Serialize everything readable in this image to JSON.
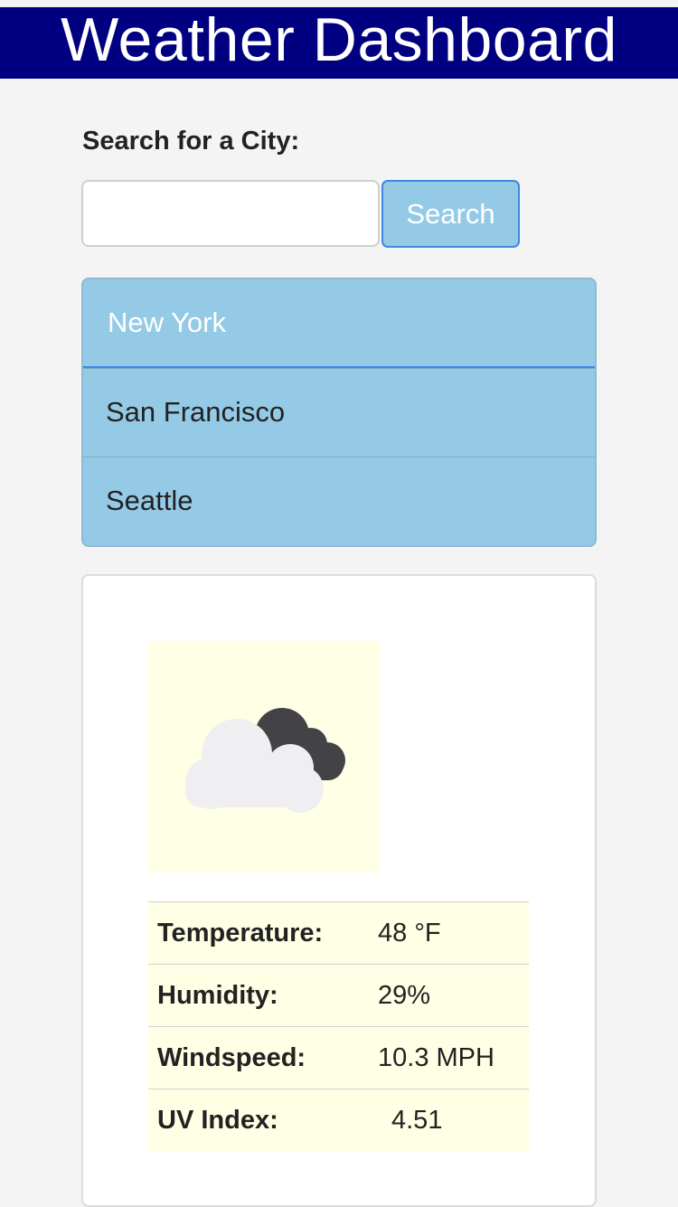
{
  "header": {
    "title": "Weather Dashboard"
  },
  "search": {
    "label": "Search for a City:",
    "input_value": "",
    "placeholder": "",
    "button_label": "Search"
  },
  "cities": [
    {
      "name": "New York",
      "active": true
    },
    {
      "name": "San Francisco",
      "active": false
    },
    {
      "name": "Seattle",
      "active": false
    }
  ],
  "weather": {
    "icon": "partly-cloudy-icon",
    "stats": [
      {
        "label": "Temperature:",
        "value": "48 °F"
      },
      {
        "label": "Humidity:",
        "value": "29%"
      },
      {
        "label": "Windspeed:",
        "value": "10.3 MPH"
      },
      {
        "label": "UV Index:",
        "value": "4.51"
      }
    ]
  },
  "colors": {
    "header_bg": "#000080",
    "accent": "#95cae6",
    "accent_border": "#3f87e0",
    "weather_bg": "#ffffe6"
  }
}
